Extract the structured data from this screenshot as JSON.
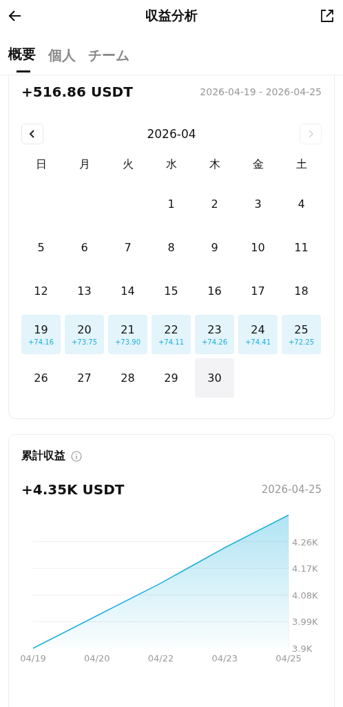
{
  "header": {
    "title": "収益分析"
  },
  "tabs": [
    {
      "label": "概要",
      "selected": true
    },
    {
      "label": "個人",
      "selected": false
    },
    {
      "label": "チーム",
      "selected": false
    }
  ],
  "weekly": {
    "amount": "+516.86 USDT",
    "range": "2026-04-19 - 2026-04-25",
    "calendar": {
      "month": "2026-04",
      "prev_disabled": false,
      "next_disabled": true,
      "weekdays": [
        "日",
        "月",
        "火",
        "水",
        "木",
        "金",
        "土"
      ],
      "weeks": [
        [
          {
            "kind": "blank"
          },
          {
            "kind": "blank"
          },
          {
            "kind": "blank"
          },
          {
            "kind": "day",
            "day": "1",
            "selected": false,
            "today": false
          },
          {
            "kind": "day",
            "day": "2",
            "selected": false,
            "today": false
          },
          {
            "kind": "day",
            "day": "3",
            "selected": false,
            "today": false
          },
          {
            "kind": "day",
            "day": "4",
            "selected": false,
            "today": false
          }
        ],
        [
          {
            "kind": "day",
            "day": "5",
            "selected": false,
            "today": false
          },
          {
            "kind": "day",
            "day": "6",
            "selected": false,
            "today": false
          },
          {
            "kind": "day",
            "day": "7",
            "selected": false,
            "today": false
          },
          {
            "kind": "day",
            "day": "8",
            "selected": false,
            "today": false
          },
          {
            "kind": "day",
            "day": "9",
            "selected": false,
            "today": false
          },
          {
            "kind": "day",
            "day": "10",
            "selected": false,
            "today": false
          },
          {
            "kind": "day",
            "day": "11",
            "selected": false,
            "today": false
          }
        ],
        [
          {
            "kind": "day",
            "day": "12",
            "selected": false,
            "today": false
          },
          {
            "kind": "day",
            "day": "13",
            "selected": false,
            "today": false
          },
          {
            "kind": "day",
            "day": "14",
            "selected": false,
            "today": false
          },
          {
            "kind": "day",
            "day": "15",
            "selected": false,
            "today": false
          },
          {
            "kind": "day",
            "day": "16",
            "selected": false,
            "today": false
          },
          {
            "kind": "day",
            "day": "17",
            "selected": false,
            "today": false
          },
          {
            "kind": "day",
            "day": "18",
            "selected": false,
            "today": false
          }
        ],
        [
          {
            "kind": "day",
            "day": "19",
            "earning": "+74.16",
            "selected": true,
            "today": false
          },
          {
            "kind": "day",
            "day": "20",
            "earning": "+73.75",
            "selected": true,
            "today": false
          },
          {
            "kind": "day",
            "day": "21",
            "earning": "+73.90",
            "selected": true,
            "today": false
          },
          {
            "kind": "day",
            "day": "22",
            "earning": "+74.11",
            "selected": true,
            "today": false
          },
          {
            "kind": "day",
            "day": "23",
            "earning": "+74.26",
            "selected": true,
            "today": false
          },
          {
            "kind": "day",
            "day": "24",
            "earning": "+74.41",
            "selected": true,
            "today": false
          },
          {
            "kind": "day",
            "day": "25",
            "earning": "+72.25",
            "selected": true,
            "today": false
          }
        ],
        [
          {
            "kind": "day",
            "day": "26",
            "selected": false,
            "today": false
          },
          {
            "kind": "day",
            "day": "27",
            "selected": false,
            "today": false
          },
          {
            "kind": "day",
            "day": "28",
            "selected": false,
            "today": false
          },
          {
            "kind": "day",
            "day": "29",
            "selected": false,
            "today": false
          },
          {
            "kind": "day",
            "day": "30",
            "selected": false,
            "today": true
          },
          {
            "kind": "blank"
          },
          {
            "kind": "blank"
          }
        ]
      ]
    }
  },
  "cumulative": {
    "title": "累計収益",
    "amount": "+4.35K USDT",
    "date": "2026-04-25",
    "chart_data": {
      "type": "area",
      "grid": true,
      "categories": [
        "04/19",
        "04/20",
        "04/22",
        "04/23",
        "04/25"
      ],
      "series": [
        {
          "color": "#1fb0dc",
          "values": [
            3.9,
            4.01,
            4.12,
            4.24,
            4.35
          ]
        }
      ],
      "ylim": [
        3.9,
        4.35
      ],
      "yticks": [
        {
          "value": 3.9,
          "label": "3.9K"
        },
        {
          "value": 3.99,
          "label": "3.99K"
        },
        {
          "value": 4.08,
          "label": "4.08K"
        },
        {
          "value": 4.17,
          "label": "4.17K"
        },
        {
          "value": 4.26,
          "label": "4.26K"
        }
      ]
    }
  }
}
